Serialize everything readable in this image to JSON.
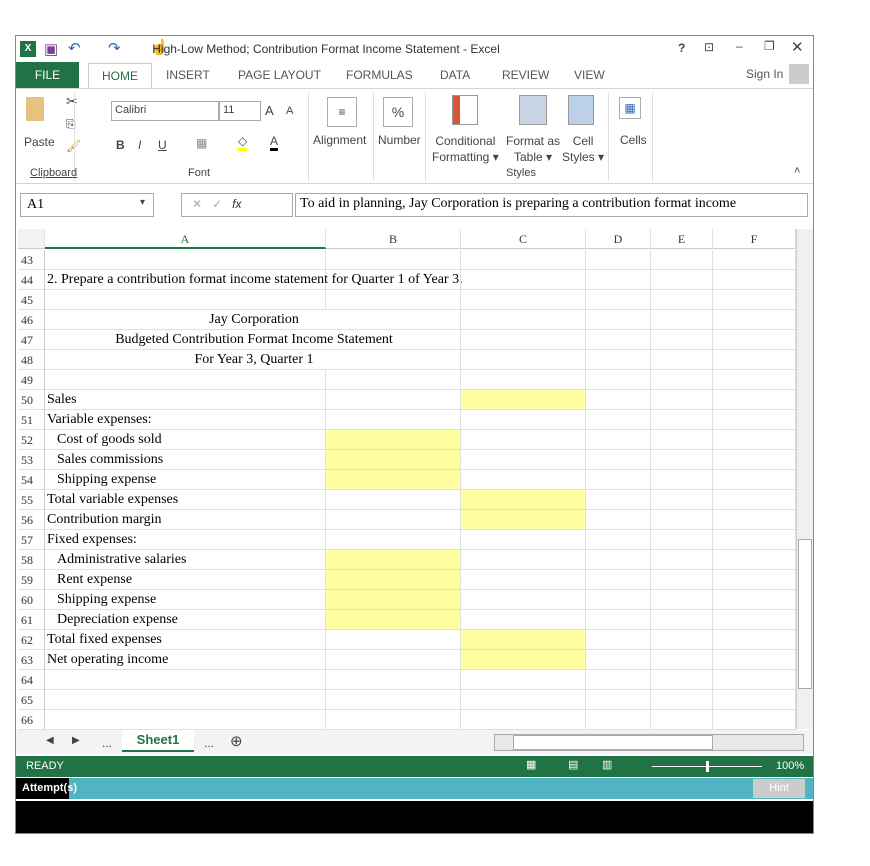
{
  "window": {
    "title": "High-Low Method; Contribution Format Income Statement - Excel",
    "help": "?",
    "sign_in": "Sign In"
  },
  "menu": {
    "file": "FILE",
    "tabs": [
      "HOME",
      "INSERT",
      "PAGE LAYOUT",
      "FORMULAS",
      "DATA",
      "REVIEW",
      "VIEW"
    ]
  },
  "ribbon": {
    "paste": "Paste",
    "font_name": "Calibri",
    "font_size": "11",
    "bold": "B",
    "italic": "I",
    "underline": "U",
    "alignment": "Alignment",
    "number": "Number",
    "percent": "%",
    "conditional_formatting": [
      "Conditional",
      "Formatting"
    ],
    "format_as_table": [
      "Format as",
      "Table"
    ],
    "cell_styles": [
      "Cell",
      "Styles"
    ],
    "cells": "Cells",
    "groups": {
      "clipboard": "Clipboard",
      "font": "Font",
      "styles": "Styles"
    }
  },
  "formula_bar": {
    "name_box": "A1",
    "fx": "fx",
    "formula": "To aid in planning, Jay Corporation is preparing a contribution format income"
  },
  "columns": [
    "A",
    "B",
    "C",
    "D",
    "E",
    "F"
  ],
  "rows": [
    {
      "n": "43",
      "a": ""
    },
    {
      "n": "44",
      "a": "2. Prepare a contribution format income statement for Quarter 1 of Year 3."
    },
    {
      "n": "45",
      "a": ""
    },
    {
      "n": "46",
      "a": "Jay Corporation",
      "center": true
    },
    {
      "n": "47",
      "a": "Budgeted Contribution Format Income Statement",
      "center": true
    },
    {
      "n": "48",
      "a": "For Year 3, Quarter 1",
      "center": true
    },
    {
      "n": "49",
      "a": ""
    },
    {
      "n": "50",
      "a": "Sales",
      "yc": true
    },
    {
      "n": "51",
      "a": "Variable expenses:"
    },
    {
      "n": "52",
      "a": "Cost of goods sold",
      "indent": true,
      "yb": true
    },
    {
      "n": "53",
      "a": "Sales commissions",
      "indent": true,
      "yb": true
    },
    {
      "n": "54",
      "a": "Shipping expense",
      "indent": true,
      "yb": true
    },
    {
      "n": "55",
      "a": "Total variable expenses",
      "yc": true
    },
    {
      "n": "56",
      "a": "Contribution margin",
      "yc": true
    },
    {
      "n": "57",
      "a": "Fixed expenses:"
    },
    {
      "n": "58",
      "a": "Administrative salaries",
      "indent": true,
      "yb": true
    },
    {
      "n": "59",
      "a": "Rent expense",
      "indent": true,
      "yb": true
    },
    {
      "n": "60",
      "a": "Shipping expense",
      "indent": true,
      "yb": true
    },
    {
      "n": "61",
      "a": "Depreciation expense",
      "indent": true,
      "yb": true
    },
    {
      "n": "62",
      "a": "Total fixed expenses",
      "yc": true
    },
    {
      "n": "63",
      "a": "Net operating income",
      "yc": true
    },
    {
      "n": "64",
      "a": ""
    },
    {
      "n": "65",
      "a": ""
    },
    {
      "n": "66",
      "a": ""
    }
  ],
  "sheet_tabs": {
    "ellipsis": "...",
    "active": "Sheet1"
  },
  "status": {
    "ready": "READY",
    "zoom": "100%"
  },
  "attempts": {
    "label": "Attempt(s)",
    "hint": "Hint"
  },
  "colors": {
    "accent": "#217346",
    "input_cell": "#ffff9f",
    "attempt_bar": "#50b4c3"
  }
}
